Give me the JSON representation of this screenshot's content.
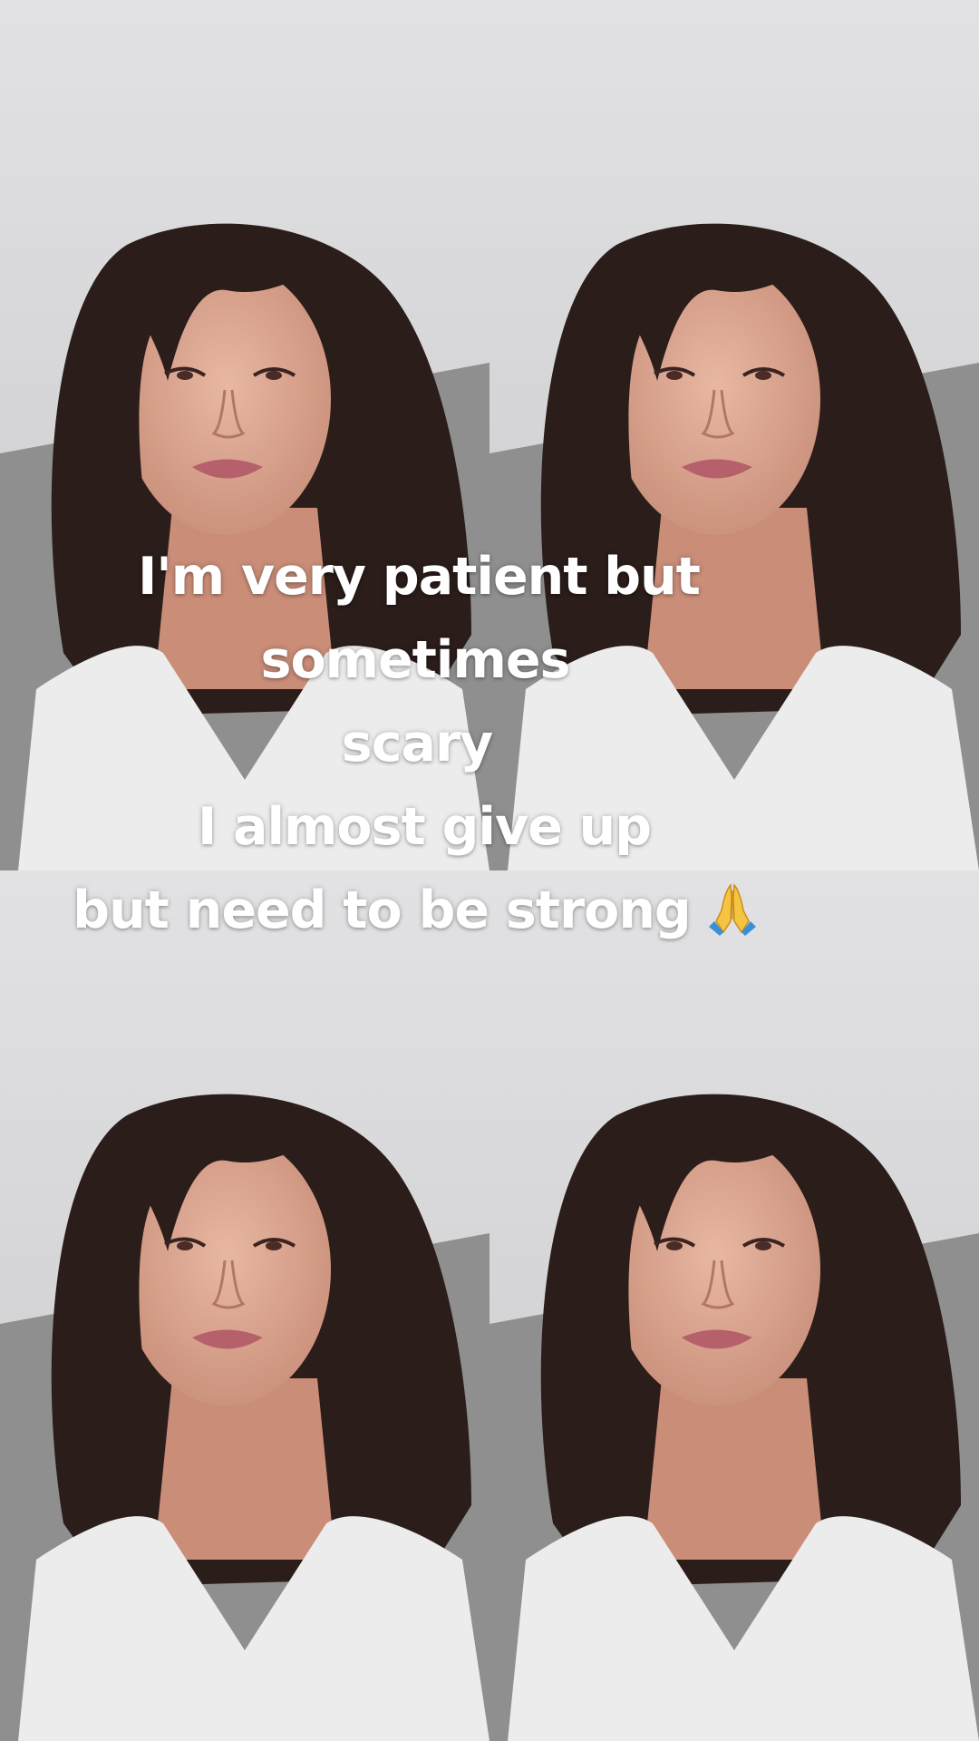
{
  "caption": {
    "lines": [
      "I'm very patient but",
      "sometimes",
      "scary",
      "I almost give up",
      "but need to be strong"
    ],
    "emoji_icon": "folded-hands-icon"
  },
  "layout_grid": {
    "tiles": 4,
    "subject": "portrait-selfie"
  },
  "colors": {
    "wall": "#d6d6d8",
    "sofa": "#8f8f8f",
    "skin": "#d9a58f",
    "hair": "#2a1d1a",
    "shirt": "#ececec",
    "caption_text": "#ffffff"
  }
}
